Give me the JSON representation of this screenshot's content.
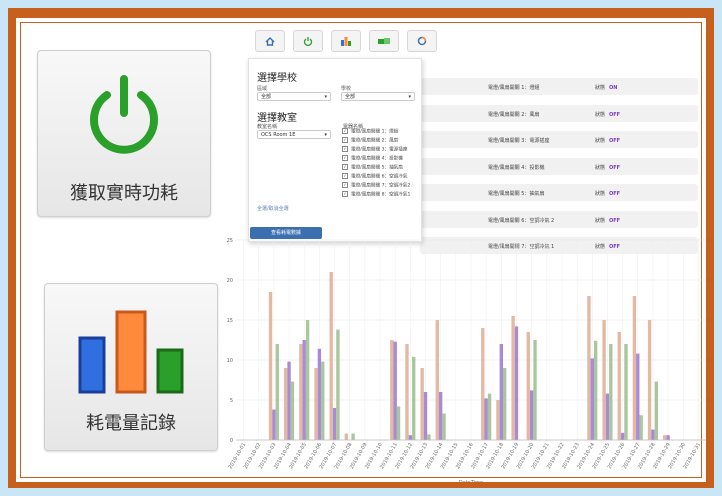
{
  "buttons": {
    "power_label": "獲取實時功耗",
    "history_label": "耗電量記錄"
  },
  "panel": {
    "school_heading": "選擇學校",
    "district_label": "區域",
    "district_value": "全部",
    "school_label": "學校",
    "school_value": "全部",
    "classroom_heading": "選擇教室",
    "classroom_label": "教室名稱",
    "classroom_value": "OCS Room 1E",
    "devices_label": "電器名稱",
    "devices": [
      "電燈/風扇開關 1：燈組",
      "電燈/風扇開關 2：風扇",
      "電燈/風扇開關 3：電源插座",
      "電燈/風扇開關 4：投影機",
      "電燈/風扇開關 5：抽氣扇",
      "電燈/風扇開關 6：空調冷氣",
      "電燈/風扇開關 7：空調冷氣2",
      "電燈/風扇開關 8：空調冷氣1"
    ],
    "select_all_link": "全選/取消全選",
    "submit_label": "查看耗電數據"
  },
  "rows": [
    {
      "name": "電燈/風扇開關 1：燈組",
      "state": "狀態",
      "value": "ON"
    },
    {
      "name": "電燈/風扇開關 2：風扇",
      "state": "狀態",
      "value": "OFF"
    },
    {
      "name": "電燈/風扇開關 3：電源插座",
      "state": "狀態",
      "value": "OFF"
    },
    {
      "name": "電燈/風扇開關 4：投影機",
      "state": "狀態",
      "value": "OFF"
    },
    {
      "name": "電燈/風扇開關 5：抽氣扇",
      "state": "狀態",
      "value": "OFF"
    },
    {
      "name": "電燈/風扇開關 6：空調冷氣 2",
      "state": "狀態",
      "value": "OFF"
    },
    {
      "name": "電燈/風扇開關 7：空調冷氣 1",
      "state": "狀態",
      "value": "OFF"
    }
  ],
  "colors": {
    "frame": "#c6601c",
    "power_icon": "#2aa02a",
    "bar_blue": "#2f6fe0",
    "bar_orange": "#ff8a3c",
    "bar_green": "#2aa02a",
    "series_tan": "#e3b9a2",
    "series_purple": "#a98ad8",
    "series_green": "#a9c79c"
  },
  "icons": {
    "power": "power-icon",
    "bars": "bar-chart-icon",
    "toolbar": [
      "home-icon",
      "power-icon",
      "bar-chart-icon",
      "devices-icon",
      "refresh-icon"
    ]
  },
  "chart_data": {
    "type": "bar",
    "xlabel": "DateTime",
    "ylabel": "",
    "ylim": [
      0,
      25
    ],
    "yticks": [
      0,
      5,
      10,
      15,
      20,
      25
    ],
    "categories": [
      "2019-10-01",
      "2019-10-02",
      "2019-10-03",
      "2019-10-04",
      "2019-10-05",
      "2019-10-06",
      "2019-10-07",
      "2019-10-08",
      "2019-10-09",
      "2019-10-10",
      "2019-10-11",
      "2019-10-12",
      "2019-10-13",
      "2019-10-14",
      "2019-10-15",
      "2019-10-16",
      "2019-10-17",
      "2019-10-18",
      "2019-10-19",
      "2019-10-20",
      "2019-10-21",
      "2019-10-22",
      "2019-10-23",
      "2019-10-24",
      "2019-10-25",
      "2019-10-26",
      "2019-10-27",
      "2019-10-28",
      "2019-10-29",
      "2019-10-30",
      "2019-10-31"
    ],
    "series": [
      {
        "values": [
          0,
          0,
          18.5,
          9,
          12,
          9,
          21,
          0.8,
          0,
          0,
          12.5,
          12,
          9,
          15,
          0,
          0,
          14,
          5,
          15.5,
          13.5,
          0,
          0,
          0,
          18,
          15,
          13.5,
          18,
          15,
          0.6,
          0,
          0
        ]
      },
      {
        "values": [
          0,
          0,
          3.8,
          9.8,
          12.5,
          11.4,
          4,
          0,
          0,
          0,
          12.3,
          0.6,
          6,
          6,
          0,
          0,
          5.2,
          12,
          14.2,
          6.2,
          0,
          0,
          0,
          10.2,
          5.8,
          0.9,
          10.8,
          1.3,
          0.6,
          0,
          0
        ]
      },
      {
        "values": [
          0,
          0,
          12,
          7.3,
          15,
          9.8,
          13.8,
          0.8,
          0,
          0,
          4.2,
          10.4,
          0.7,
          3.3,
          0,
          0,
          5.8,
          9,
          0,
          12.5,
          0,
          0,
          0,
          12.4,
          12,
          12,
          3.1,
          7.3,
          0,
          0,
          0
        ]
      }
    ]
  }
}
